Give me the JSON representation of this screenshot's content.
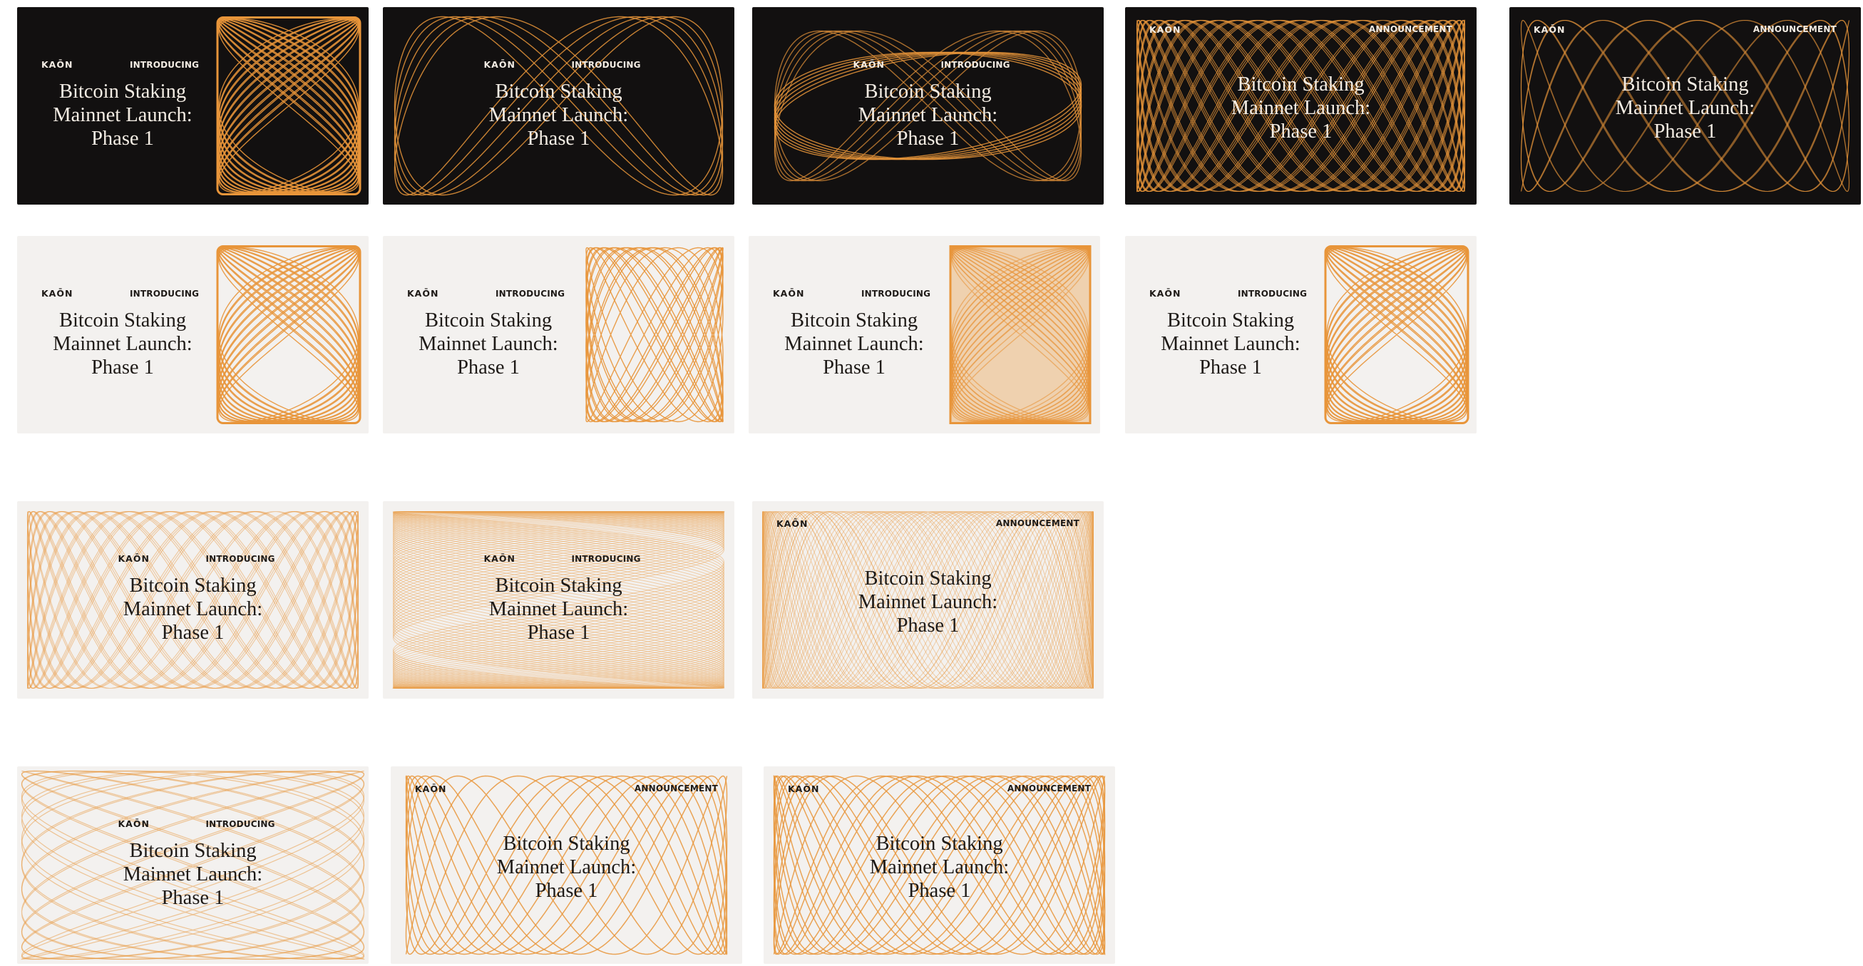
{
  "copy": {
    "logo": "KAŌN",
    "tag_intro": "INTRODUCING",
    "tag_announce": "ANNOUNCEMENT",
    "title_line1": "Bitcoin Staking",
    "title_line2": "Mainnet Launch:",
    "title_line3": "Phase 1"
  },
  "colors": {
    "dark_bg": "#121010",
    "light_bg": "#f3f1ef",
    "accent_orange": "#e8953a",
    "light_text": "#f4ede4",
    "dark_text": "#1e1a17"
  },
  "cards": [
    {
      "id": "row1-card1",
      "theme": "dark",
      "tag": "tag_intro",
      "pattern": "side-lissajous"
    },
    {
      "id": "row1-card2",
      "theme": "dark",
      "tag": "tag_intro",
      "pattern": "wide-loops"
    },
    {
      "id": "row1-card3",
      "theme": "dark",
      "tag": "tag_intro",
      "pattern": "flat-ellipses"
    },
    {
      "id": "row1-card4",
      "theme": "dark",
      "tag": "tag_announce",
      "pattern": "dense-full"
    },
    {
      "id": "row1-card5",
      "theme": "dark",
      "tag": "tag_announce",
      "pattern": "sparse-full"
    },
    {
      "id": "row2-card1",
      "theme": "light",
      "tag": "tag_intro",
      "pattern": "side-lissajous"
    },
    {
      "id": "row2-card2",
      "theme": "light",
      "tag": "tag_intro",
      "pattern": "side-loops"
    },
    {
      "id": "row2-card3",
      "theme": "light",
      "tag": "tag_intro",
      "pattern": "side-filled"
    },
    {
      "id": "row2-card4",
      "theme": "light",
      "tag": "tag_intro",
      "pattern": "side-twist"
    },
    {
      "id": "row3-card1",
      "theme": "light",
      "tag": "tag_intro",
      "pattern": "full-light"
    },
    {
      "id": "row3-card2",
      "theme": "light",
      "tag": "tag_intro",
      "pattern": "full-light-dense"
    },
    {
      "id": "row3-card3",
      "theme": "light",
      "tag": "tag_announce",
      "pattern": "full-horizontal"
    },
    {
      "id": "row4-card1",
      "theme": "light",
      "tag": "tag_intro",
      "pattern": "full-sparse"
    },
    {
      "id": "row4-card2",
      "theme": "light",
      "tag": "tag_announce",
      "pattern": "full-loops"
    },
    {
      "id": "row4-card3",
      "theme": "light",
      "tag": "tag_announce",
      "pattern": "full-loops-dense"
    }
  ]
}
